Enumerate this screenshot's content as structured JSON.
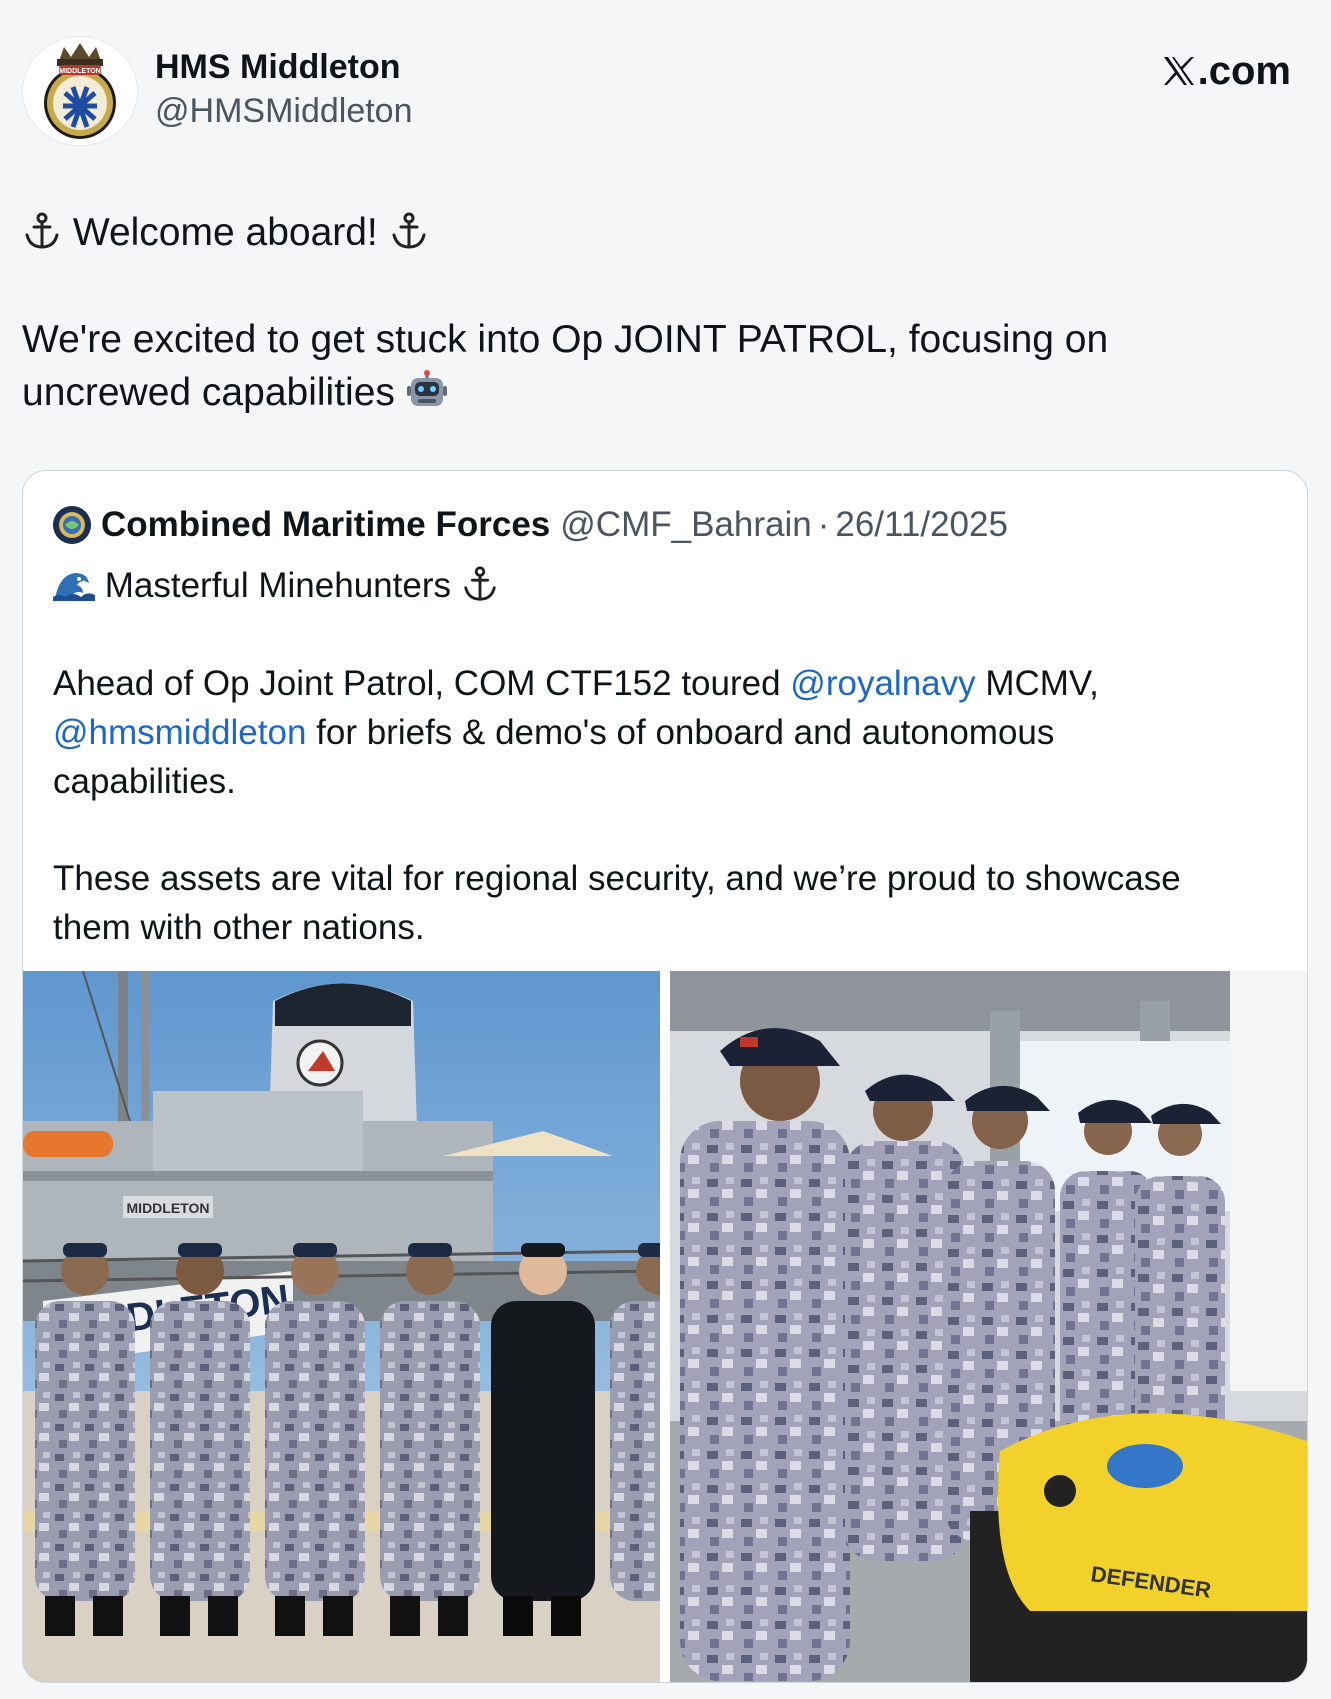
{
  "author": {
    "display_name": "HMS Middleton",
    "handle": "@HMSMiddleton",
    "avatar_icon": "ship-crest-icon",
    "crest_text": "MIDDLETON"
  },
  "site": {
    "label": ".com",
    "logo_icon": "x-logo-icon"
  },
  "tweet": {
    "line1": " Welcome aboard! ",
    "line2": "We're excited to get stuck into Op JOINT PATROL, focusing on",
    "line3": "uncrewed capabilities ",
    "icons": [
      "anchor-icon",
      "robot-icon"
    ]
  },
  "quoted": {
    "name": "Combined Maritime Forces",
    "handle": "@CMF_Bahrain",
    "separator": "·",
    "date": "26/11/2025",
    "line1": " Masterful Minehunters ",
    "p2_a": "Ahead of Op Joint Patrol, COM CTF152 toured ",
    "p2_mention1": "@royalnavy",
    "p2_b": " MCMV,",
    "p2_mention2": "@hmsmiddleton",
    "p2_c": " for briefs & demo's of onboard and autonomous",
    "p2_d": "capabilities.",
    "p3_a": "These assets are vital for regional security, and we’re proud to showcase",
    "p3_b": "them with other nations.",
    "icons": [
      "wave-icon",
      "anchor-icon"
    ]
  },
  "photos": {
    "left": {
      "ship_name": "MIDDLETON",
      "banner_text": "MIDDLETON",
      "persons": 6
    },
    "right": {
      "drone_label": "DEFENDER",
      "persons": 5
    }
  },
  "colors": {
    "mention": "#1d68c6",
    "text": "#0f1419",
    "secondary": "#4a5560",
    "border": "#cfd6dc",
    "camo": "#8d8fa6"
  }
}
